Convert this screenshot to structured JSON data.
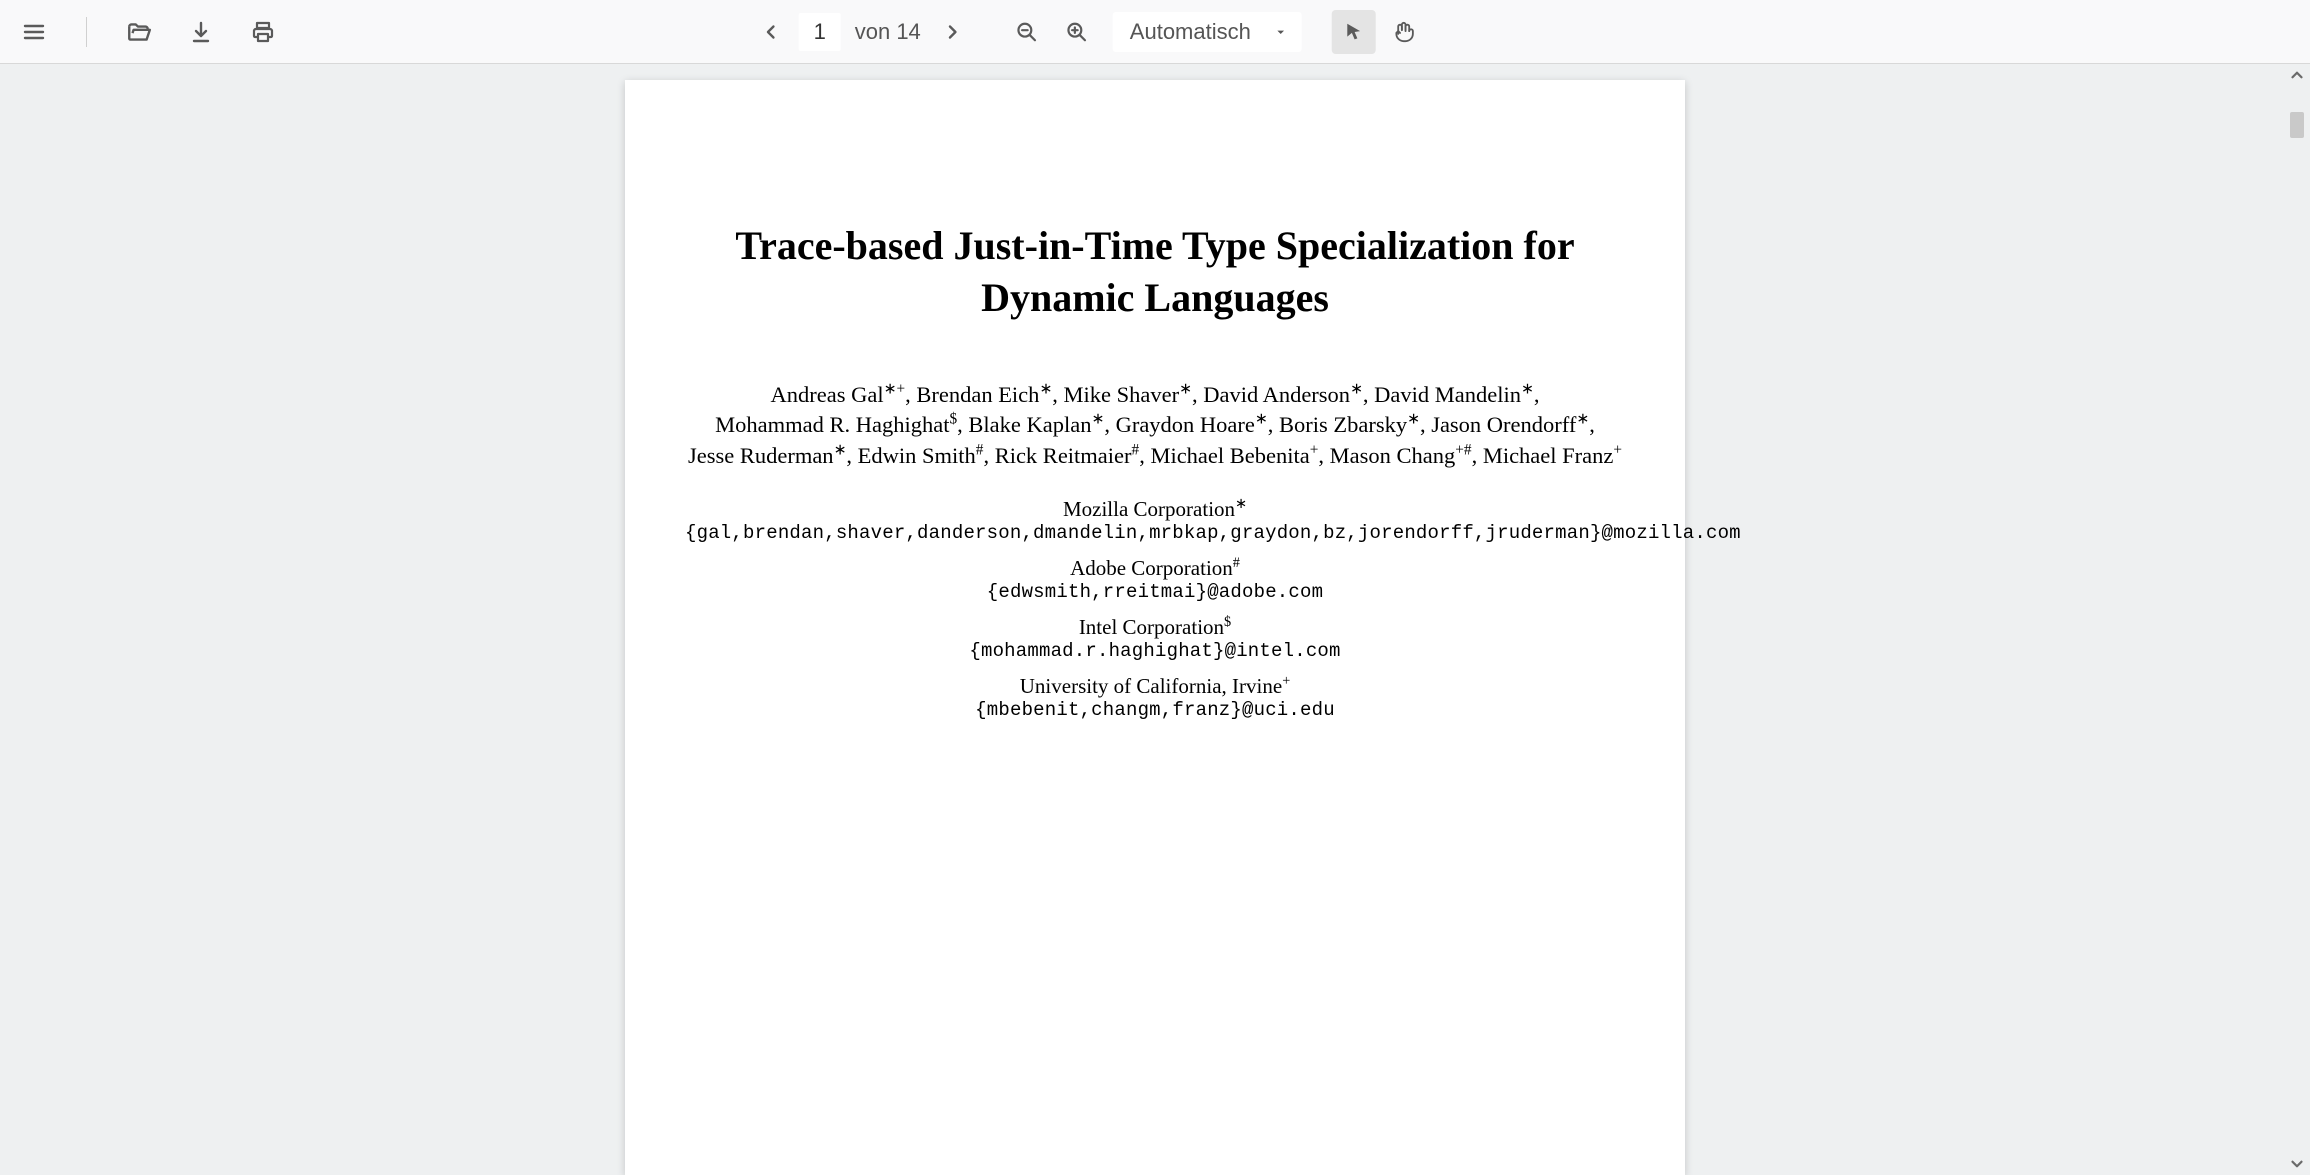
{
  "toolbar": {
    "page_current": "1",
    "page_sep_word": "von",
    "page_total": "14",
    "zoom_label": "Automatisch"
  },
  "paper": {
    "title": "Trace-based Just-in-Time Type Specialization for Dynamic Languages",
    "authors_lines": [
      "Andreas Gal∗+, Brendan Eich∗, Mike Shaver∗, David Anderson∗, David Mandelin∗,",
      "Mohammad R. Haghighat$, Blake Kaplan∗, Graydon Hoare∗, Boris Zbarsky∗, Jason Orendorff∗,",
      "Jesse Ruderman∗, Edwin Smith#, Rick Reitmaier#, Michael Bebenita+, Mason Chang+#, Michael Franz+"
    ],
    "affiliations": [
      {
        "name": "Mozilla Corporation∗",
        "email": "{gal,brendan,shaver,danderson,dmandelin,mrbkap,graydon,bz,jorendorff,jruderman}@mozilla.com"
      },
      {
        "name": "Adobe Corporation#",
        "email": "{edwsmith,rreitmai}@adobe.com"
      },
      {
        "name": "Intel Corporation$",
        "email": "{mohammad.r.haghighat}@intel.com"
      },
      {
        "name": "University of California, Irvine+",
        "email": "{mbebenit,changm,franz}@uci.edu"
      }
    ]
  }
}
